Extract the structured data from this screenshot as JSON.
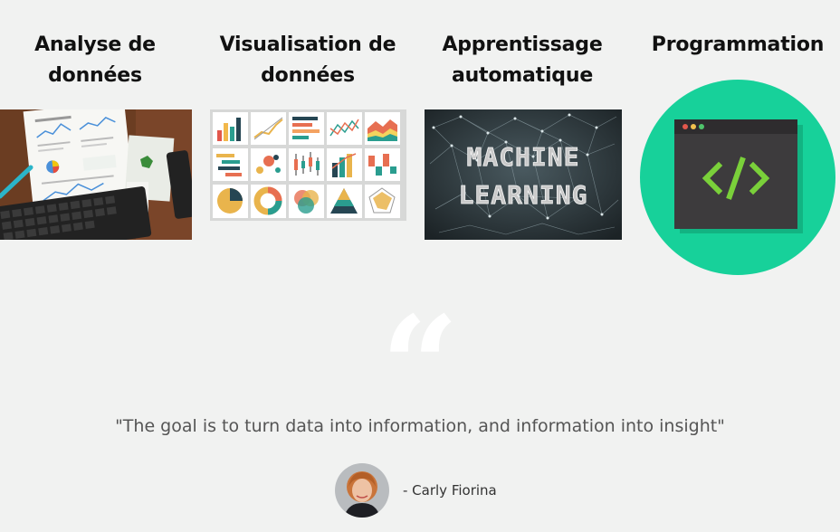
{
  "topics": [
    {
      "title_line1": "Analyse de",
      "title_line2": "données",
      "image": "data-analysis-desk-photo"
    },
    {
      "title_line1": "Visualisation de",
      "title_line2": "données",
      "image": "chart-types-grid"
    },
    {
      "title_line1": "Apprentissage",
      "title_line2": "automatique",
      "image": "machine-learning-banner"
    },
    {
      "title_line1": "Programmation",
      "title_line2": "",
      "image": "code-window-icon"
    }
  ],
  "ml_banner": {
    "line1": "MACHINE",
    "line2": "LEARNING"
  },
  "quote": {
    "icon": "quote-open-icon",
    "text": "\"The goal is to turn data into information, and information into insight\"",
    "author": "- Carly Fiorina"
  },
  "colors": {
    "background": "#f1f2f1",
    "programming_circle": "#17d19a",
    "code_window": "#3d3b3d",
    "code_symbol": "#7ad03a"
  }
}
